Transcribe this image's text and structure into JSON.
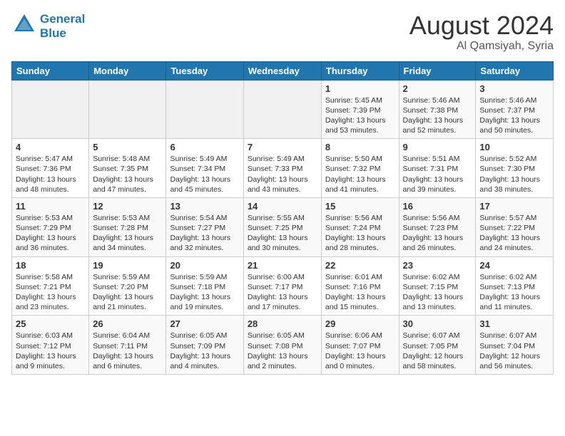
{
  "logo": {
    "line1": "General",
    "line2": "Blue"
  },
  "title": "August 2024",
  "location": "Al Qamsiyah, Syria",
  "weekdays": [
    "Sunday",
    "Monday",
    "Tuesday",
    "Wednesday",
    "Thursday",
    "Friday",
    "Saturday"
  ],
  "weeks": [
    [
      {
        "day": "",
        "info": ""
      },
      {
        "day": "",
        "info": ""
      },
      {
        "day": "",
        "info": ""
      },
      {
        "day": "",
        "info": ""
      },
      {
        "day": "1",
        "info": "Sunrise: 5:45 AM\nSunset: 7:39 PM\nDaylight: 13 hours\nand 53 minutes."
      },
      {
        "day": "2",
        "info": "Sunrise: 5:46 AM\nSunset: 7:38 PM\nDaylight: 13 hours\nand 52 minutes."
      },
      {
        "day": "3",
        "info": "Sunrise: 5:46 AM\nSunset: 7:37 PM\nDaylight: 13 hours\nand 50 minutes."
      }
    ],
    [
      {
        "day": "4",
        "info": "Sunrise: 5:47 AM\nSunset: 7:36 PM\nDaylight: 13 hours\nand 48 minutes."
      },
      {
        "day": "5",
        "info": "Sunrise: 5:48 AM\nSunset: 7:35 PM\nDaylight: 13 hours\nand 47 minutes."
      },
      {
        "day": "6",
        "info": "Sunrise: 5:49 AM\nSunset: 7:34 PM\nDaylight: 13 hours\nand 45 minutes."
      },
      {
        "day": "7",
        "info": "Sunrise: 5:49 AM\nSunset: 7:33 PM\nDaylight: 13 hours\nand 43 minutes."
      },
      {
        "day": "8",
        "info": "Sunrise: 5:50 AM\nSunset: 7:32 PM\nDaylight: 13 hours\nand 41 minutes."
      },
      {
        "day": "9",
        "info": "Sunrise: 5:51 AM\nSunset: 7:31 PM\nDaylight: 13 hours\nand 39 minutes."
      },
      {
        "day": "10",
        "info": "Sunrise: 5:52 AM\nSunset: 7:30 PM\nDaylight: 13 hours\nand 38 minutes."
      }
    ],
    [
      {
        "day": "11",
        "info": "Sunrise: 5:53 AM\nSunset: 7:29 PM\nDaylight: 13 hours\nand 36 minutes."
      },
      {
        "day": "12",
        "info": "Sunrise: 5:53 AM\nSunset: 7:28 PM\nDaylight: 13 hours\nand 34 minutes."
      },
      {
        "day": "13",
        "info": "Sunrise: 5:54 AM\nSunset: 7:27 PM\nDaylight: 13 hours\nand 32 minutes."
      },
      {
        "day": "14",
        "info": "Sunrise: 5:55 AM\nSunset: 7:25 PM\nDaylight: 13 hours\nand 30 minutes."
      },
      {
        "day": "15",
        "info": "Sunrise: 5:56 AM\nSunset: 7:24 PM\nDaylight: 13 hours\nand 28 minutes."
      },
      {
        "day": "16",
        "info": "Sunrise: 5:56 AM\nSunset: 7:23 PM\nDaylight: 13 hours\nand 26 minutes."
      },
      {
        "day": "17",
        "info": "Sunrise: 5:57 AM\nSunset: 7:22 PM\nDaylight: 13 hours\nand 24 minutes."
      }
    ],
    [
      {
        "day": "18",
        "info": "Sunrise: 5:58 AM\nSunset: 7:21 PM\nDaylight: 13 hours\nand 23 minutes."
      },
      {
        "day": "19",
        "info": "Sunrise: 5:59 AM\nSunset: 7:20 PM\nDaylight: 13 hours\nand 21 minutes."
      },
      {
        "day": "20",
        "info": "Sunrise: 5:59 AM\nSunset: 7:18 PM\nDaylight: 13 hours\nand 19 minutes."
      },
      {
        "day": "21",
        "info": "Sunrise: 6:00 AM\nSunset: 7:17 PM\nDaylight: 13 hours\nand 17 minutes."
      },
      {
        "day": "22",
        "info": "Sunrise: 6:01 AM\nSunset: 7:16 PM\nDaylight: 13 hours\nand 15 minutes."
      },
      {
        "day": "23",
        "info": "Sunrise: 6:02 AM\nSunset: 7:15 PM\nDaylight: 13 hours\nand 13 minutes."
      },
      {
        "day": "24",
        "info": "Sunrise: 6:02 AM\nSunset: 7:13 PM\nDaylight: 13 hours\nand 11 minutes."
      }
    ],
    [
      {
        "day": "25",
        "info": "Sunrise: 6:03 AM\nSunset: 7:12 PM\nDaylight: 13 hours\nand 9 minutes."
      },
      {
        "day": "26",
        "info": "Sunrise: 6:04 AM\nSunset: 7:11 PM\nDaylight: 13 hours\nand 6 minutes."
      },
      {
        "day": "27",
        "info": "Sunrise: 6:05 AM\nSunset: 7:09 PM\nDaylight: 13 hours\nand 4 minutes."
      },
      {
        "day": "28",
        "info": "Sunrise: 6:05 AM\nSunset: 7:08 PM\nDaylight: 13 hours\nand 2 minutes."
      },
      {
        "day": "29",
        "info": "Sunrise: 6:06 AM\nSunset: 7:07 PM\nDaylight: 13 hours\nand 0 minutes."
      },
      {
        "day": "30",
        "info": "Sunrise: 6:07 AM\nSunset: 7:05 PM\nDaylight: 12 hours\nand 58 minutes."
      },
      {
        "day": "31",
        "info": "Sunrise: 6:07 AM\nSunset: 7:04 PM\nDaylight: 12 hours\nand 56 minutes."
      }
    ]
  ]
}
